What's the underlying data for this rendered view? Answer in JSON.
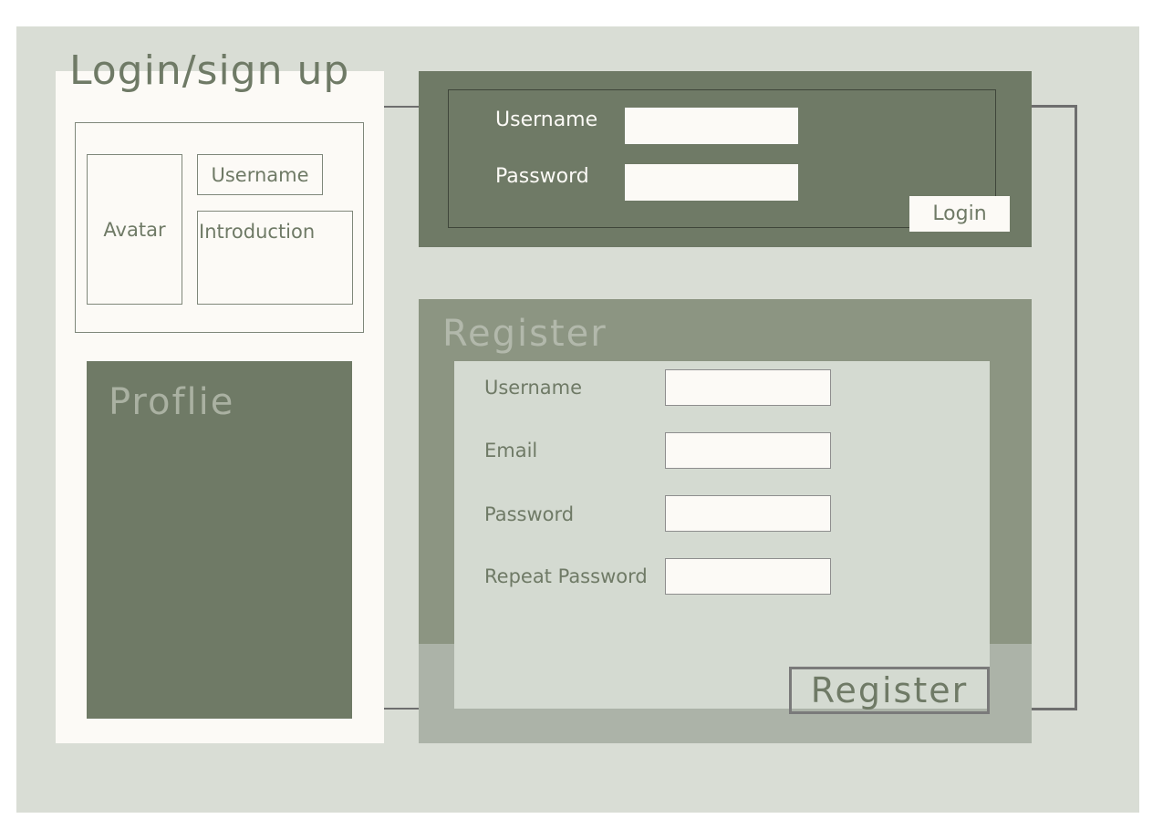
{
  "page_title": "Login/sign up",
  "profile_card": {
    "avatar_label": "Avatar",
    "username_label": "Username",
    "introduction_label": "Introduction"
  },
  "profile_panel": {
    "title": "Proflie"
  },
  "login": {
    "username_label": "Username",
    "password_label": "Password",
    "username_value": "",
    "password_value": "",
    "button_label": "Login"
  },
  "register": {
    "title": "Register",
    "fields": [
      {
        "label": "Username",
        "value": ""
      },
      {
        "label": "Email",
        "value": ""
      },
      {
        "label": "Password",
        "value": ""
      },
      {
        "label": "Repeat Password",
        "value": ""
      }
    ],
    "button_label": "Register"
  },
  "colors": {
    "background": "#d9ddd5",
    "dark_green": "#6f7a66",
    "mid_green": "#8c9582",
    "light_panel": "#fcfaf6"
  }
}
